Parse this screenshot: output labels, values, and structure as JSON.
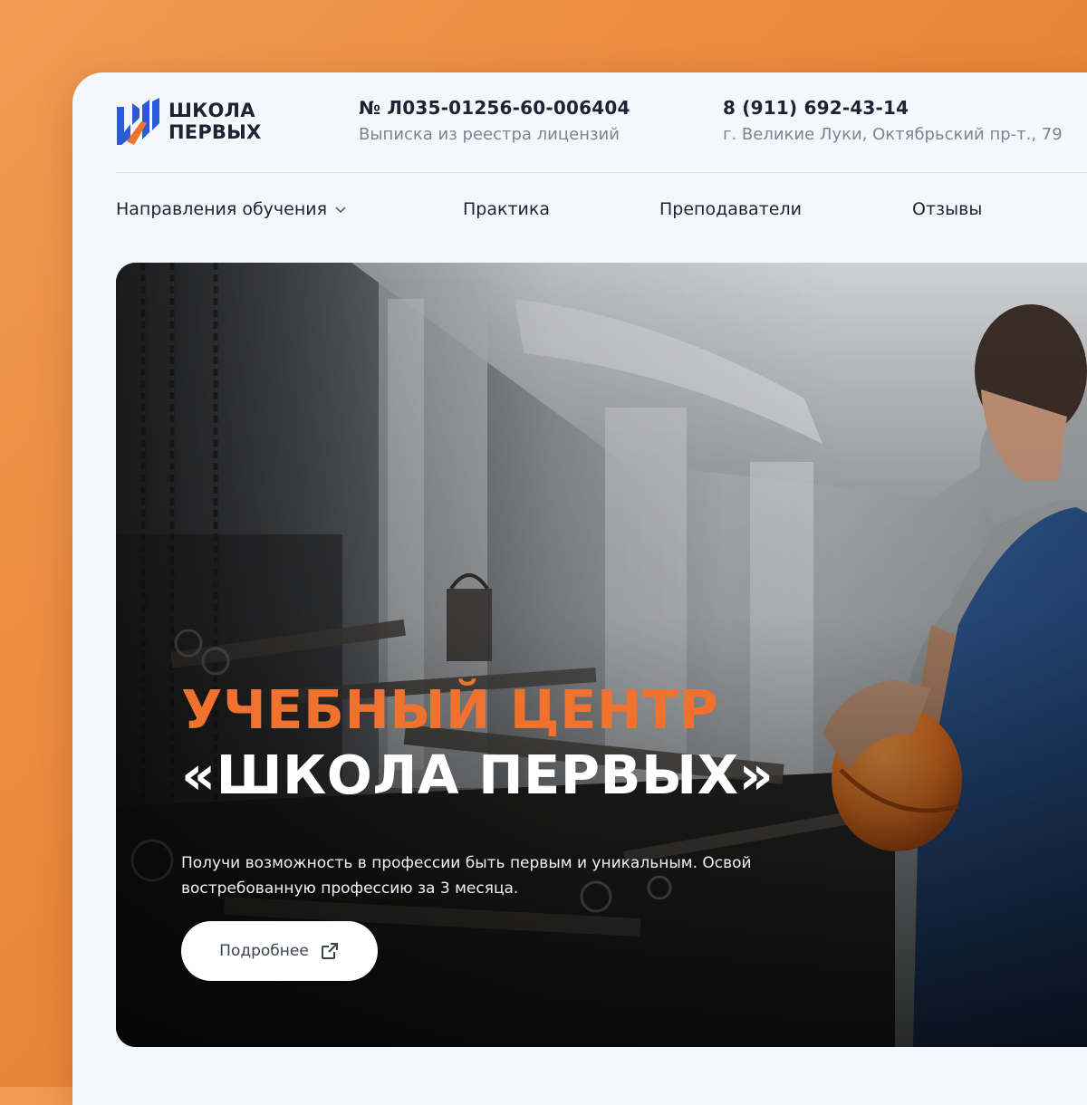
{
  "brand": {
    "name_line1": "ШКОЛА",
    "name_line2": "ПЕРВЫХ",
    "logo_colors": [
      "#2a5bd7",
      "#f0722e"
    ]
  },
  "header": {
    "license_number": "№ Л035-01256-60-006404",
    "license_caption": "Выписка из реестра лицензий",
    "phone": "8 (911) 692-43-14",
    "address": "г. Великие Луки, Октябрьский пр-т., 79"
  },
  "nav": {
    "items": [
      {
        "label": "Направления обучения",
        "icon": "chevron-down-icon"
      },
      {
        "label": "Практика"
      },
      {
        "label": "Преподаватели"
      },
      {
        "label": "Отзывы"
      }
    ]
  },
  "hero": {
    "title_line1": "УЧЕБНЫЙ ЦЕНТР",
    "title_line2": "«ШКОЛА ПЕРВЫХ»",
    "description": "Получи возможность в профессии быть первым и уникальным. Освой востребованную профессию за 3 месяца.",
    "button_label": "Подробнее",
    "button_icon": "external-link-icon"
  },
  "colors": {
    "background": "#ec8a3c",
    "accent": "#f0722e",
    "text_dark": "#1c2333",
    "text_muted": "#7c8594"
  }
}
